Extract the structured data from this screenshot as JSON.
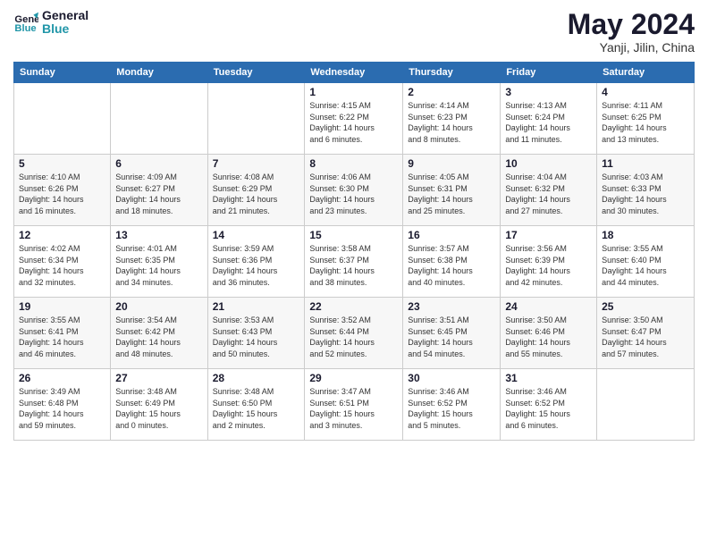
{
  "header": {
    "logo_general": "General",
    "logo_blue": "Blue",
    "month_title": "May 2024",
    "subtitle": "Yanji, Jilin, China"
  },
  "days_of_week": [
    "Sunday",
    "Monday",
    "Tuesday",
    "Wednesday",
    "Thursday",
    "Friday",
    "Saturday"
  ],
  "weeks": [
    [
      {
        "day": "",
        "info": ""
      },
      {
        "day": "",
        "info": ""
      },
      {
        "day": "",
        "info": ""
      },
      {
        "day": "1",
        "info": "Sunrise: 4:15 AM\nSunset: 6:22 PM\nDaylight: 14 hours\nand 6 minutes."
      },
      {
        "day": "2",
        "info": "Sunrise: 4:14 AM\nSunset: 6:23 PM\nDaylight: 14 hours\nand 8 minutes."
      },
      {
        "day": "3",
        "info": "Sunrise: 4:13 AM\nSunset: 6:24 PM\nDaylight: 14 hours\nand 11 minutes."
      },
      {
        "day": "4",
        "info": "Sunrise: 4:11 AM\nSunset: 6:25 PM\nDaylight: 14 hours\nand 13 minutes."
      }
    ],
    [
      {
        "day": "5",
        "info": "Sunrise: 4:10 AM\nSunset: 6:26 PM\nDaylight: 14 hours\nand 16 minutes."
      },
      {
        "day": "6",
        "info": "Sunrise: 4:09 AM\nSunset: 6:27 PM\nDaylight: 14 hours\nand 18 minutes."
      },
      {
        "day": "7",
        "info": "Sunrise: 4:08 AM\nSunset: 6:29 PM\nDaylight: 14 hours\nand 21 minutes."
      },
      {
        "day": "8",
        "info": "Sunrise: 4:06 AM\nSunset: 6:30 PM\nDaylight: 14 hours\nand 23 minutes."
      },
      {
        "day": "9",
        "info": "Sunrise: 4:05 AM\nSunset: 6:31 PM\nDaylight: 14 hours\nand 25 minutes."
      },
      {
        "day": "10",
        "info": "Sunrise: 4:04 AM\nSunset: 6:32 PM\nDaylight: 14 hours\nand 27 minutes."
      },
      {
        "day": "11",
        "info": "Sunrise: 4:03 AM\nSunset: 6:33 PM\nDaylight: 14 hours\nand 30 minutes."
      }
    ],
    [
      {
        "day": "12",
        "info": "Sunrise: 4:02 AM\nSunset: 6:34 PM\nDaylight: 14 hours\nand 32 minutes."
      },
      {
        "day": "13",
        "info": "Sunrise: 4:01 AM\nSunset: 6:35 PM\nDaylight: 14 hours\nand 34 minutes."
      },
      {
        "day": "14",
        "info": "Sunrise: 3:59 AM\nSunset: 6:36 PM\nDaylight: 14 hours\nand 36 minutes."
      },
      {
        "day": "15",
        "info": "Sunrise: 3:58 AM\nSunset: 6:37 PM\nDaylight: 14 hours\nand 38 minutes."
      },
      {
        "day": "16",
        "info": "Sunrise: 3:57 AM\nSunset: 6:38 PM\nDaylight: 14 hours\nand 40 minutes."
      },
      {
        "day": "17",
        "info": "Sunrise: 3:56 AM\nSunset: 6:39 PM\nDaylight: 14 hours\nand 42 minutes."
      },
      {
        "day": "18",
        "info": "Sunrise: 3:55 AM\nSunset: 6:40 PM\nDaylight: 14 hours\nand 44 minutes."
      }
    ],
    [
      {
        "day": "19",
        "info": "Sunrise: 3:55 AM\nSunset: 6:41 PM\nDaylight: 14 hours\nand 46 minutes."
      },
      {
        "day": "20",
        "info": "Sunrise: 3:54 AM\nSunset: 6:42 PM\nDaylight: 14 hours\nand 48 minutes."
      },
      {
        "day": "21",
        "info": "Sunrise: 3:53 AM\nSunset: 6:43 PM\nDaylight: 14 hours\nand 50 minutes."
      },
      {
        "day": "22",
        "info": "Sunrise: 3:52 AM\nSunset: 6:44 PM\nDaylight: 14 hours\nand 52 minutes."
      },
      {
        "day": "23",
        "info": "Sunrise: 3:51 AM\nSunset: 6:45 PM\nDaylight: 14 hours\nand 54 minutes."
      },
      {
        "day": "24",
        "info": "Sunrise: 3:50 AM\nSunset: 6:46 PM\nDaylight: 14 hours\nand 55 minutes."
      },
      {
        "day": "25",
        "info": "Sunrise: 3:50 AM\nSunset: 6:47 PM\nDaylight: 14 hours\nand 57 minutes."
      }
    ],
    [
      {
        "day": "26",
        "info": "Sunrise: 3:49 AM\nSunset: 6:48 PM\nDaylight: 14 hours\nand 59 minutes."
      },
      {
        "day": "27",
        "info": "Sunrise: 3:48 AM\nSunset: 6:49 PM\nDaylight: 15 hours\nand 0 minutes."
      },
      {
        "day": "28",
        "info": "Sunrise: 3:48 AM\nSunset: 6:50 PM\nDaylight: 15 hours\nand 2 minutes."
      },
      {
        "day": "29",
        "info": "Sunrise: 3:47 AM\nSunset: 6:51 PM\nDaylight: 15 hours\nand 3 minutes."
      },
      {
        "day": "30",
        "info": "Sunrise: 3:46 AM\nSunset: 6:52 PM\nDaylight: 15 hours\nand 5 minutes."
      },
      {
        "day": "31",
        "info": "Sunrise: 3:46 AM\nSunset: 6:52 PM\nDaylight: 15 hours\nand 6 minutes."
      },
      {
        "day": "",
        "info": ""
      }
    ]
  ]
}
